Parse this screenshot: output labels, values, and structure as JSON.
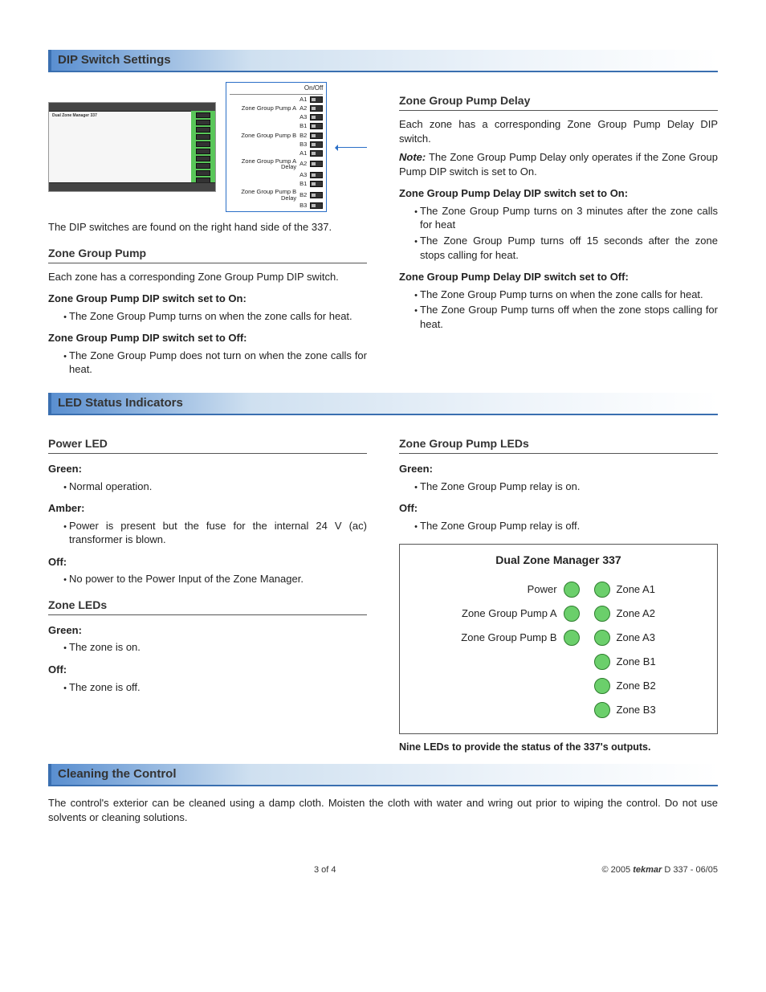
{
  "sections": {
    "dip_title": "DIP Switch Settings",
    "led_title": "LED Status Indicators",
    "cleaning_title": "Cleaning the Control"
  },
  "dip": {
    "callout_title": "On/Off",
    "groups": [
      {
        "label": "Zone Group Pump A",
        "pins": [
          "A1",
          "A2",
          "A3"
        ]
      },
      {
        "label": "Zone Group Pump B",
        "pins": [
          "B1",
          "B2",
          "B3"
        ]
      },
      {
        "label": "Zone Group Pump A Delay",
        "pins": [
          "A1",
          "A2",
          "A3"
        ]
      },
      {
        "label": "Zone Group Pump B Delay",
        "pins": [
          "B1",
          "B2",
          "B3"
        ]
      }
    ],
    "device_title": "Dual Zone Manager 337",
    "caption": "The DIP switches are found on the right hand side of the 337.",
    "zone_pump": {
      "heading": "Zone Group Pump",
      "intro": "Each zone has a corresponding Zone Group Pump DIP switch.",
      "on_title": "Zone Group Pump DIP switch set to On:",
      "on_items": [
        "The Zone Group Pump turns on when the zone calls for heat."
      ],
      "off_title": "Zone Group Pump DIP switch set to Off:",
      "off_items": [
        "The Zone Group Pump does not turn on when the zone calls for heat."
      ]
    },
    "zone_pump_delay": {
      "heading": "Zone Group Pump Delay",
      "intro": "Each zone has a corresponding Zone Group Pump Delay DIP switch.",
      "note_label": "Note:",
      "note_text": " The Zone Group Pump Delay only operates if the Zone Group Pump DIP switch is set to On.",
      "on_title": "Zone Group Pump Delay DIP switch set to On:",
      "on_items": [
        "The Zone Group Pump turns on 3 minutes after the zone calls for heat",
        "The Zone Group Pump turns off 15 seconds after the zone stops calling for heat."
      ],
      "off_title": "Zone Group Pump Delay DIP switch set to Off:",
      "off_items": [
        "The Zone Group Pump turns on when the zone calls for heat.",
        "The Zone Group Pump turns off when the zone stops calling for heat."
      ]
    }
  },
  "led": {
    "power": {
      "heading": "Power LED",
      "states": [
        {
          "label": "Green:",
          "items": [
            "Normal operation."
          ]
        },
        {
          "label": "Amber:",
          "items": [
            "Power is present but the fuse for the internal 24 V (ac) transformer is blown."
          ]
        },
        {
          "label": "Off:",
          "items": [
            "No power to the Power Input of the Zone Manager."
          ]
        }
      ]
    },
    "zone": {
      "heading": "Zone LEDs",
      "states": [
        {
          "label": "Green:",
          "items": [
            "The zone is on."
          ]
        },
        {
          "label": "Off:",
          "items": [
            "The zone is off."
          ]
        }
      ]
    },
    "pump": {
      "heading": "Zone Group Pump LEDs",
      "states": [
        {
          "label": "Green:",
          "items": [
            "The Zone Group Pump relay is on."
          ]
        },
        {
          "label": "Off:",
          "items": [
            "The Zone Group Pump relay is off."
          ]
        }
      ]
    },
    "panel": {
      "title": "Dual Zone Manager 337",
      "left": [
        "Power",
        "Zone Group Pump A",
        "Zone Group Pump B"
      ],
      "right": [
        "Zone A1",
        "Zone A2",
        "Zone A3",
        "Zone B1",
        "Zone B2",
        "Zone B3"
      ]
    },
    "panel_caption": "Nine LEDs to provide the status of the 337's outputs."
  },
  "cleaning": {
    "text": "The control's exterior can be cleaned using a damp cloth. Moisten the cloth with water and wring out prior to wiping the control. Do not use solvents or cleaning solutions."
  },
  "footer": {
    "page": "3 of 4",
    "copyright": "© 2005 ",
    "brand": "tekmar",
    "doc": " D 337 - 06/05"
  }
}
